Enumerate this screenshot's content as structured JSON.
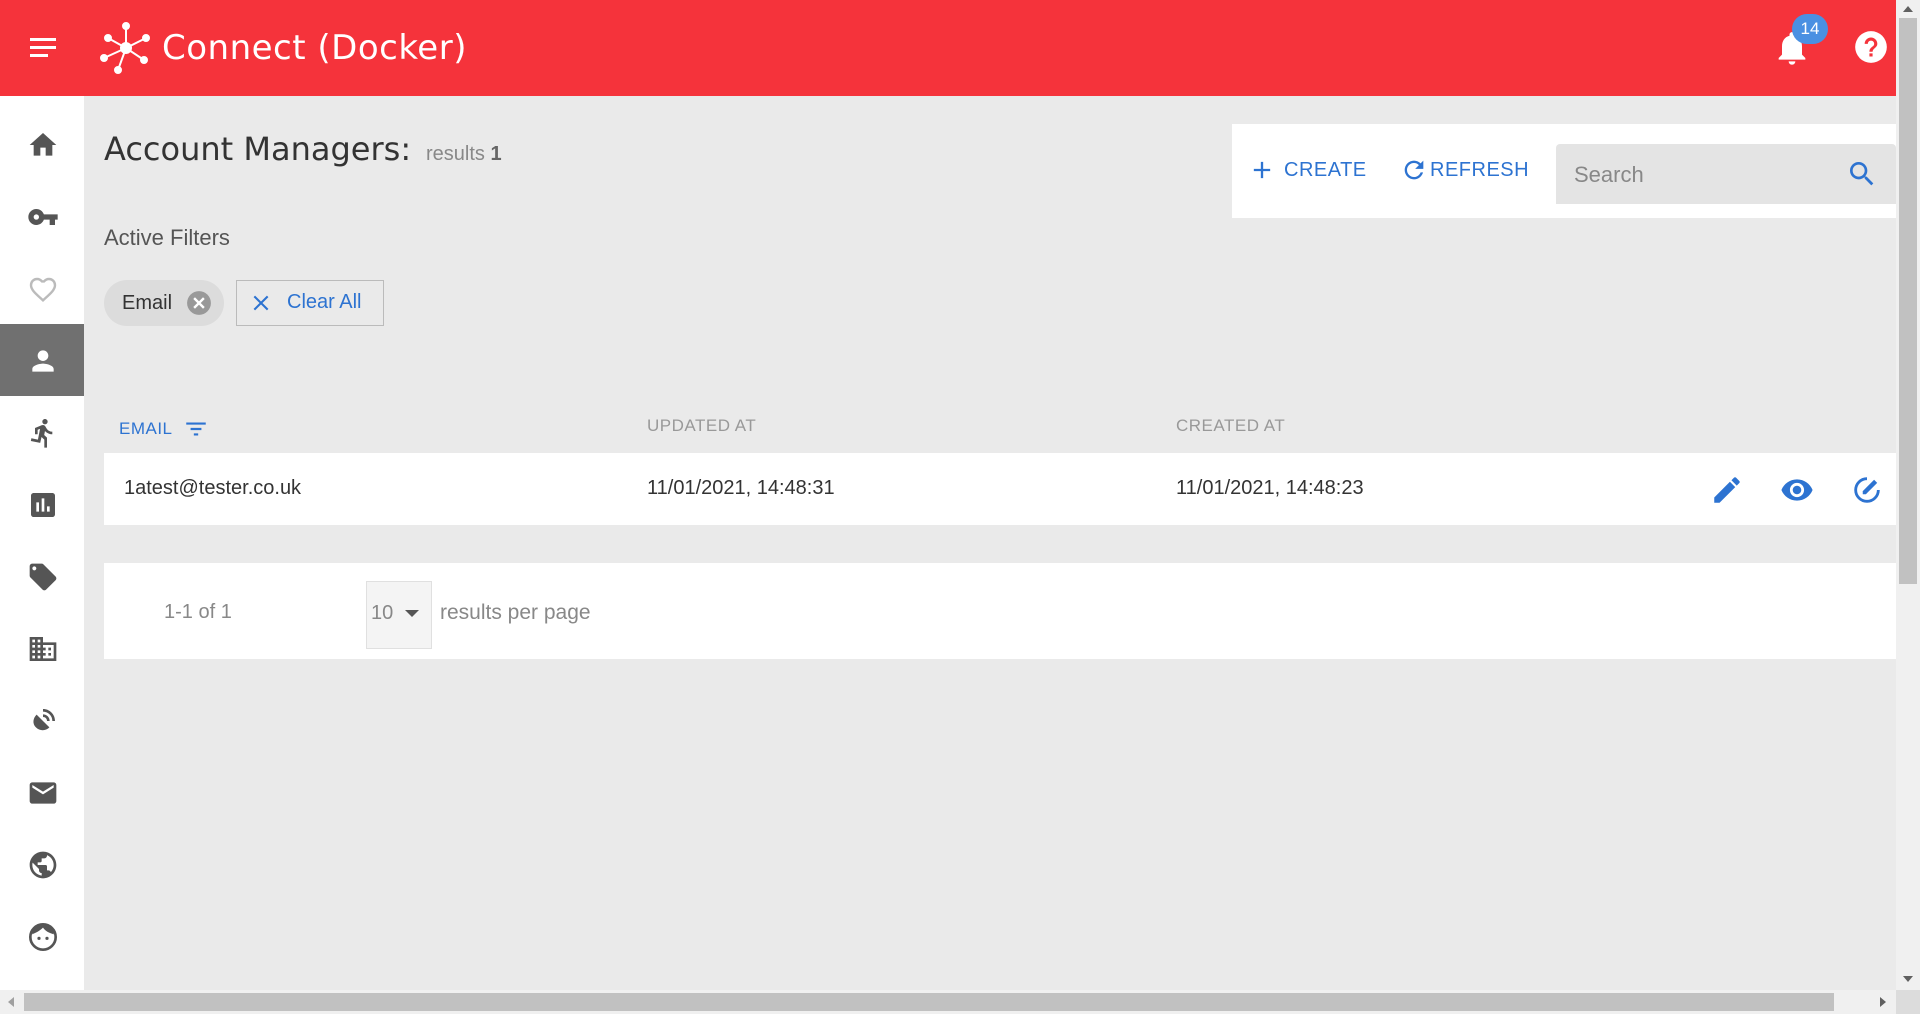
{
  "header": {
    "title": "Connect (Docker)",
    "notification_count": "14",
    "brand_color": "#f5333b"
  },
  "sidebar": {
    "items": [
      {
        "icon": "home-icon"
      },
      {
        "icon": "key-icon"
      },
      {
        "icon": "heart-icon"
      },
      {
        "icon": "person-icon",
        "active": true
      },
      {
        "icon": "running-person-icon"
      },
      {
        "icon": "bar-chart-icon"
      },
      {
        "icon": "tag-icon"
      },
      {
        "icon": "building-icon"
      },
      {
        "icon": "satellite-dish-icon"
      },
      {
        "icon": "mail-icon"
      },
      {
        "icon": "globe-icon"
      },
      {
        "icon": "face-icon"
      }
    ]
  },
  "page": {
    "title": "Account Managers:",
    "results_label": "results",
    "results_count": "1"
  },
  "toolbar": {
    "create_label": "CREATE",
    "refresh_label": "REFRESH",
    "search_placeholder": "Search",
    "search_value": ""
  },
  "filters": {
    "label": "Active Filters",
    "chips": [
      "Email"
    ],
    "clear_all_label": "Clear All"
  },
  "table": {
    "columns": [
      "EMAIL",
      "UPDATED AT",
      "CREATED AT"
    ],
    "rows": [
      {
        "email": "1atest@tester.co.uk",
        "updated_at": "11/01/2021, 14:48:31",
        "created_at": "11/01/2021, 14:48:23"
      }
    ]
  },
  "pagination": {
    "range": "1-1 of 1",
    "per_page": "10",
    "per_page_label": "results per page"
  },
  "colors": {
    "accent": "#2d73d1",
    "badge": "#4a90e2",
    "active_sidebar": "#707070"
  }
}
